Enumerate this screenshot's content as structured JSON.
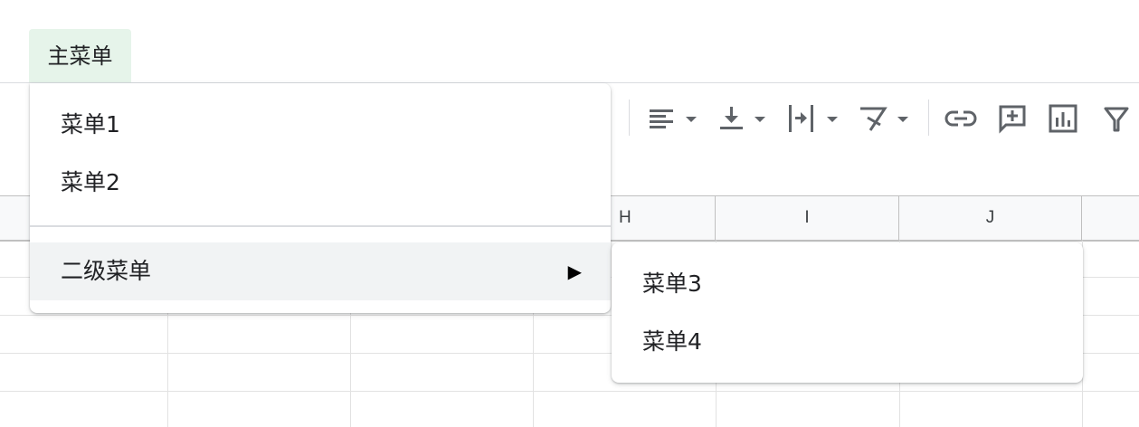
{
  "menubar": {
    "main_menu_label": "主菜单"
  },
  "main_menu": {
    "items": [
      {
        "label": "菜单1"
      },
      {
        "label": "菜单2"
      }
    ],
    "submenu_item": {
      "label": "二级菜单",
      "arrow": "▶"
    }
  },
  "sub_menu": {
    "items": [
      {
        "label": "菜单3"
      },
      {
        "label": "菜单4"
      }
    ]
  },
  "sheet": {
    "columns": [
      "H",
      "I",
      "J"
    ]
  },
  "toolbar": {
    "icons": [
      "align-left-icon",
      "vertical-align-bottom-icon",
      "text-wrap-icon",
      "text-rotate-icon",
      "link-icon",
      "comment-add-icon",
      "chart-icon",
      "filter-icon"
    ]
  },
  "colors": {
    "main_menu_bg": "#e6f4ea",
    "menu_hover_bg": "#f1f3f4",
    "icon_color": "#5f6368",
    "grid_line": "#e2e2e2"
  }
}
